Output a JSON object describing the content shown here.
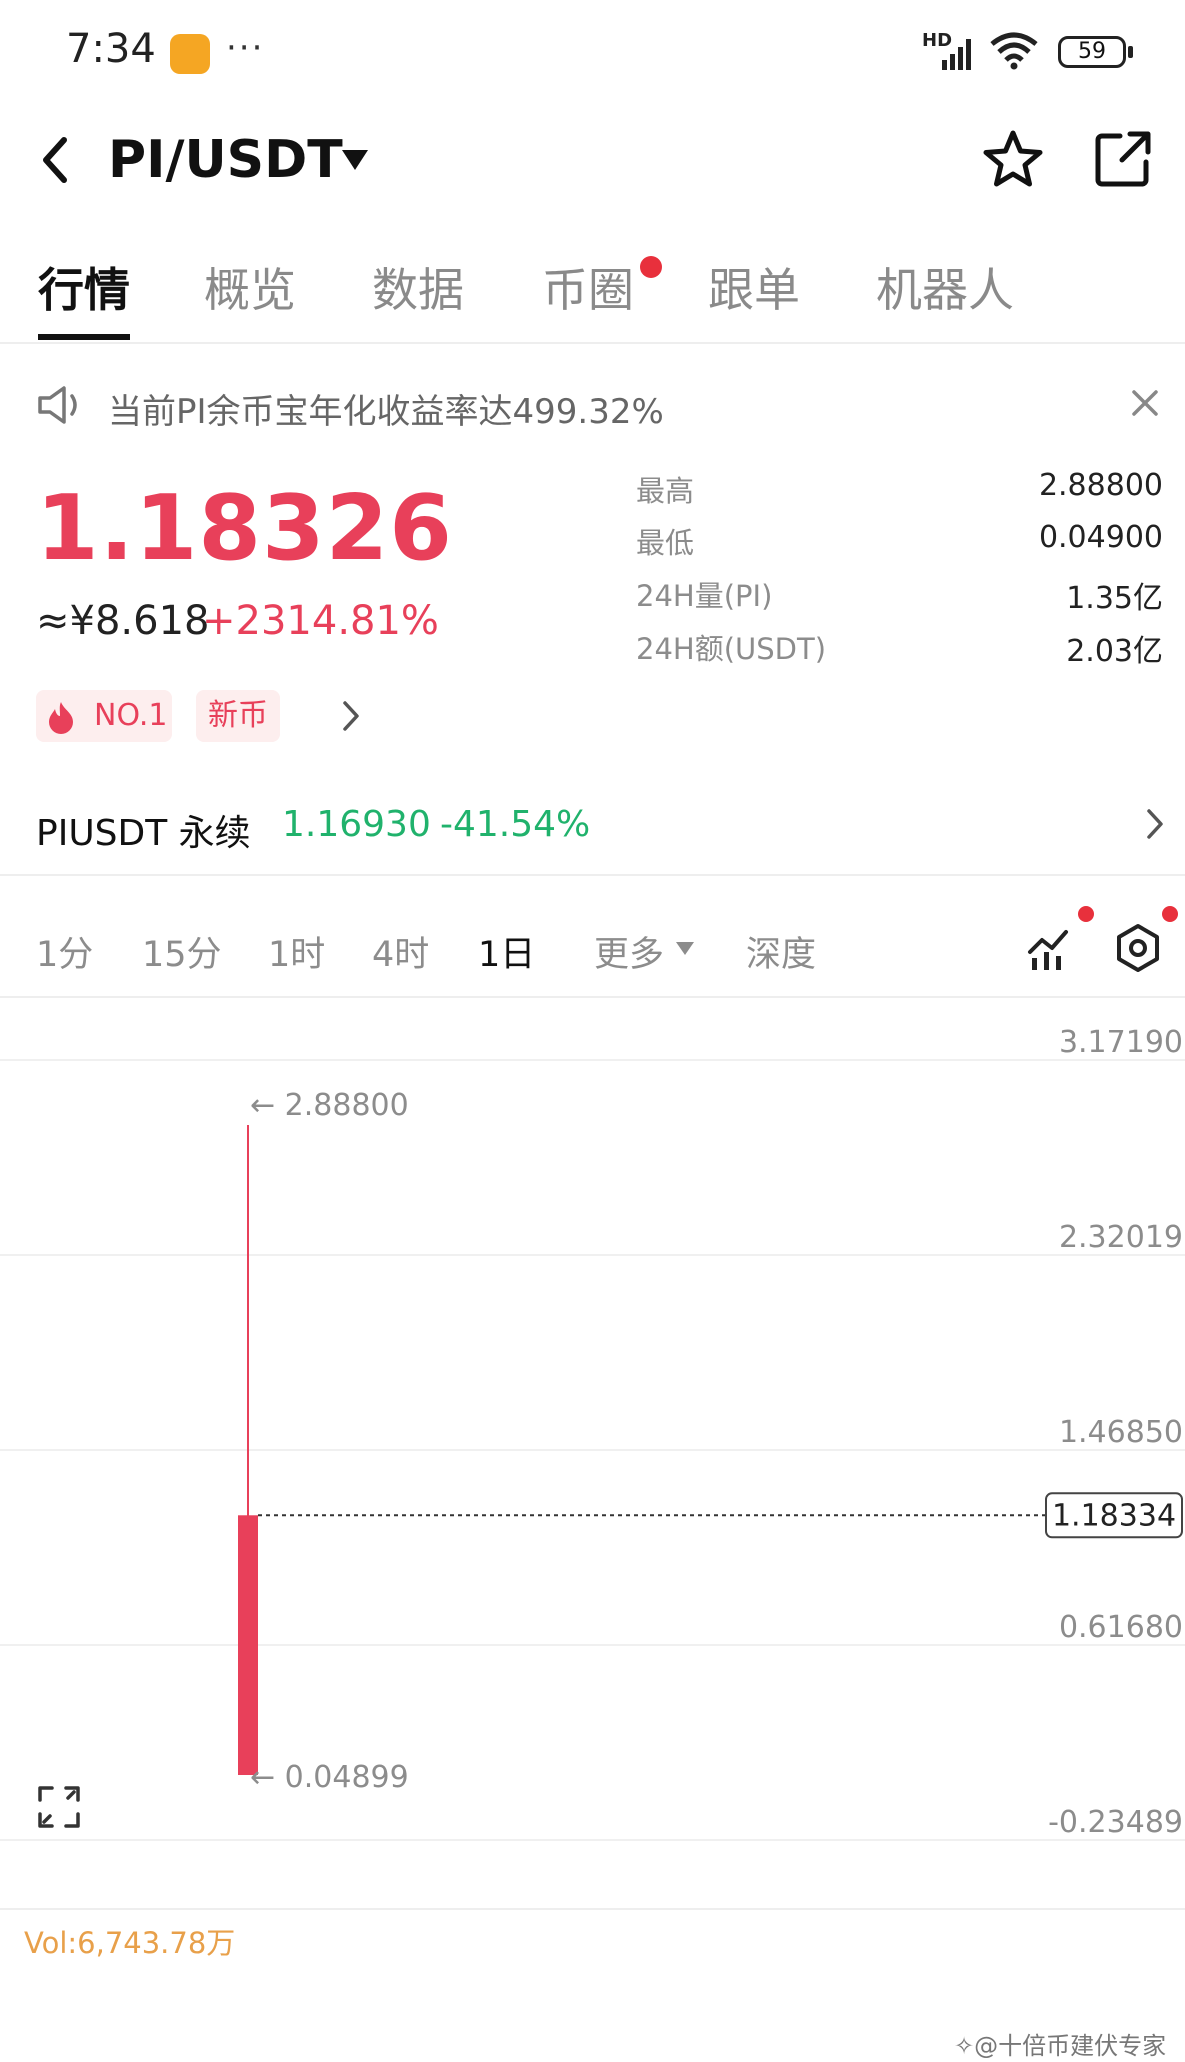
{
  "status_bar": {
    "time": "7:34",
    "more": "···",
    "signal": "HD",
    "battery": "59"
  },
  "header": {
    "pair": "PI/USDT"
  },
  "tabs": [
    "行情",
    "概览",
    "数据",
    "币圈",
    "跟单",
    "机器人"
  ],
  "notice": {
    "text": "当前PI余币宝年化收益率达499.32%"
  },
  "price": {
    "last": "1.18326",
    "cny": "≈¥8.618",
    "change": "+2314.81%"
  },
  "stats": [
    {
      "label": "最高",
      "value": "2.88800"
    },
    {
      "label": "最低",
      "value": "0.04900"
    },
    {
      "label": "24H量(PI)",
      "value": "1.35亿"
    },
    {
      "label": "24H额(USDT)",
      "value": "2.03亿"
    }
  ],
  "badges": {
    "rank": "NO.1",
    "new": "新币"
  },
  "perpetual": {
    "name": "PIUSDT 永续",
    "price": "1.16930",
    "change": "-41.54%"
  },
  "intervals": [
    "1分",
    "15分",
    "1时",
    "4时",
    "1日",
    "更多",
    "深度"
  ],
  "colors": {
    "up": "#e8405a",
    "down": "#20b26c",
    "badge_bg": "#fdeeee",
    "dot": "#e8303c",
    "volume": "#e8a04a"
  },
  "chart_data": {
    "type": "candlestick",
    "interval": "1日",
    "candles": [
      {
        "open": 0.04899,
        "close": 1.18334,
        "high": 2.888,
        "low": 0.04899
      }
    ],
    "high_label": "2.88800",
    "low_label": "0.04899",
    "current_price": "1.18334",
    "y_ticks": [
      "3.17190",
      "2.32019",
      "1.46850",
      "0.61680",
      "-0.23489"
    ],
    "ylim": [
      -0.23489,
      3.1719
    ],
    "grid": true
  },
  "volume": {
    "text": "Vol:6,743.78万"
  },
  "watermark": "✧@十倍币建伏专家"
}
